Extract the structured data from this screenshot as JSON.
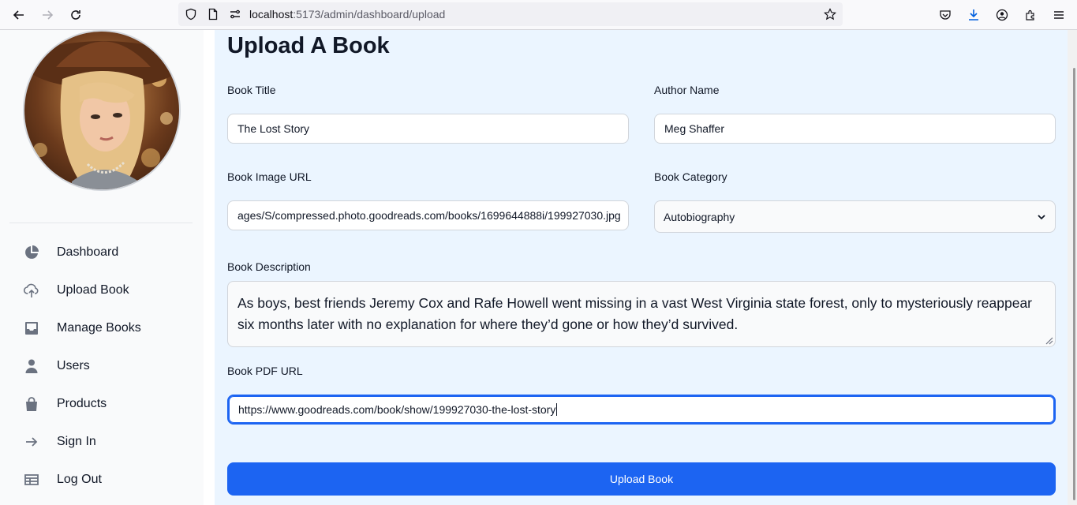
{
  "browser": {
    "url_host": "localhost",
    "url_rest": ":5173/admin/dashboard/upload"
  },
  "sidebar": {
    "items": [
      {
        "label": "Dashboard",
        "icon": "pie-chart-icon"
      },
      {
        "label": "Upload Book",
        "icon": "cloud-upload-icon"
      },
      {
        "label": "Manage Books",
        "icon": "inbox-icon"
      },
      {
        "label": "Users",
        "icon": "user-icon"
      },
      {
        "label": "Products",
        "icon": "shopping-bag-icon"
      },
      {
        "label": "Sign In",
        "icon": "arrow-right-icon"
      },
      {
        "label": "Log Out",
        "icon": "table-icon"
      }
    ]
  },
  "form": {
    "title": "Upload A Book",
    "book_title_label": "Book Title",
    "book_title_value": "The Lost Story",
    "author_label": "Author Name",
    "author_value": "Meg Shaffer",
    "image_url_label": "Book Image URL",
    "image_url_value": "ages/S/compressed.photo.goodreads.com/books/1699644888i/199927030.jpg",
    "category_label": "Book Category",
    "category_value": "Autobiography",
    "description_label": "Book Description",
    "description_value": "As boys, best friends Jeremy Cox and Rafe Howell went missing in a vast West Virginia state forest, only to mysteriously reappear six months later with no explanation for where they’d gone or how they’d survived.",
    "pdf_url_label": "Book PDF URL",
    "pdf_url_value": "https://www.goodreads.com/book/show/199927030-the-lost-story",
    "submit_label": "Upload Book"
  },
  "colors": {
    "accent": "#1c64f2",
    "main_bg": "#ebf5ff",
    "sidebar_bg": "#f9fafb"
  }
}
